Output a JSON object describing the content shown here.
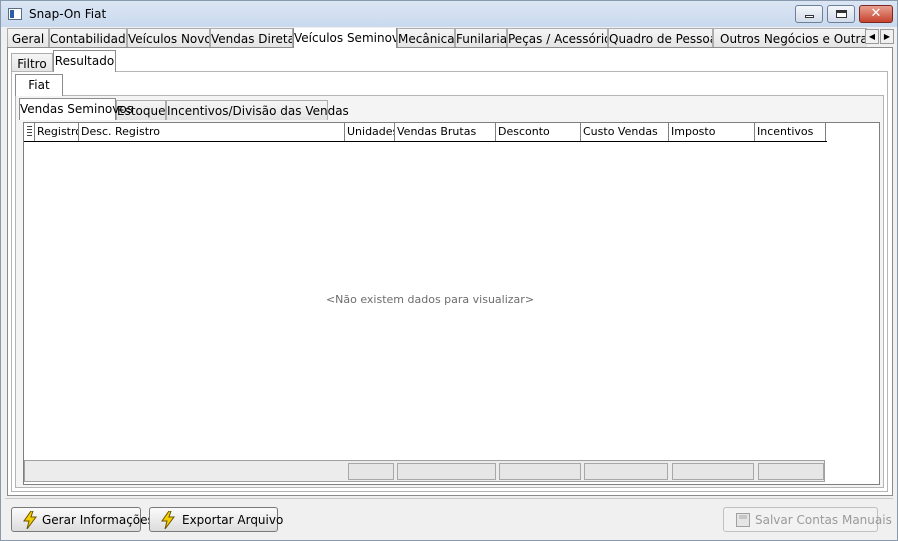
{
  "window": {
    "title": "Snap-On Fiat"
  },
  "module_tabs": [
    "Geral",
    "Contabilidade",
    "Veículos Novos",
    "Vendas Diretas",
    "Veículos Seminovos",
    "Mecânica",
    "Funilaria",
    "Peças / Acessórios",
    "Quadro de Pessoas",
    "Outros Negócios e Outras Mar"
  ],
  "active_module_tab": "Veículos Seminovos",
  "view_tabs": [
    "Filtro",
    "Resultado"
  ],
  "active_view_tab": "Resultado",
  "brand_tab": "Fiat",
  "report_tabs": [
    "Vendas Seminovos",
    "Estoque",
    "Incentivos/Divisão das Vendas"
  ],
  "active_report_tab": "Vendas Seminovos",
  "grid": {
    "columns": [
      "Registro",
      "Desc. Registro",
      "Unidades",
      "Vendas Brutas",
      "Desconto",
      "Custo Vendas",
      "Imposto",
      "Incentivos"
    ],
    "empty_message": "<Não existem dados para visualizar>"
  },
  "buttons": {
    "gerar": "Gerar Informações",
    "exportar": "Exportar Arquivo",
    "salvar": "Salvar Contas Manuais"
  },
  "icons": {
    "bolt": "lightning-bolt-icon",
    "disk": "save-disk-icon"
  },
  "colors": {
    "title_bar": "#c9d9ee",
    "close_button": "#c7432f",
    "bolt": "#f5d000"
  }
}
